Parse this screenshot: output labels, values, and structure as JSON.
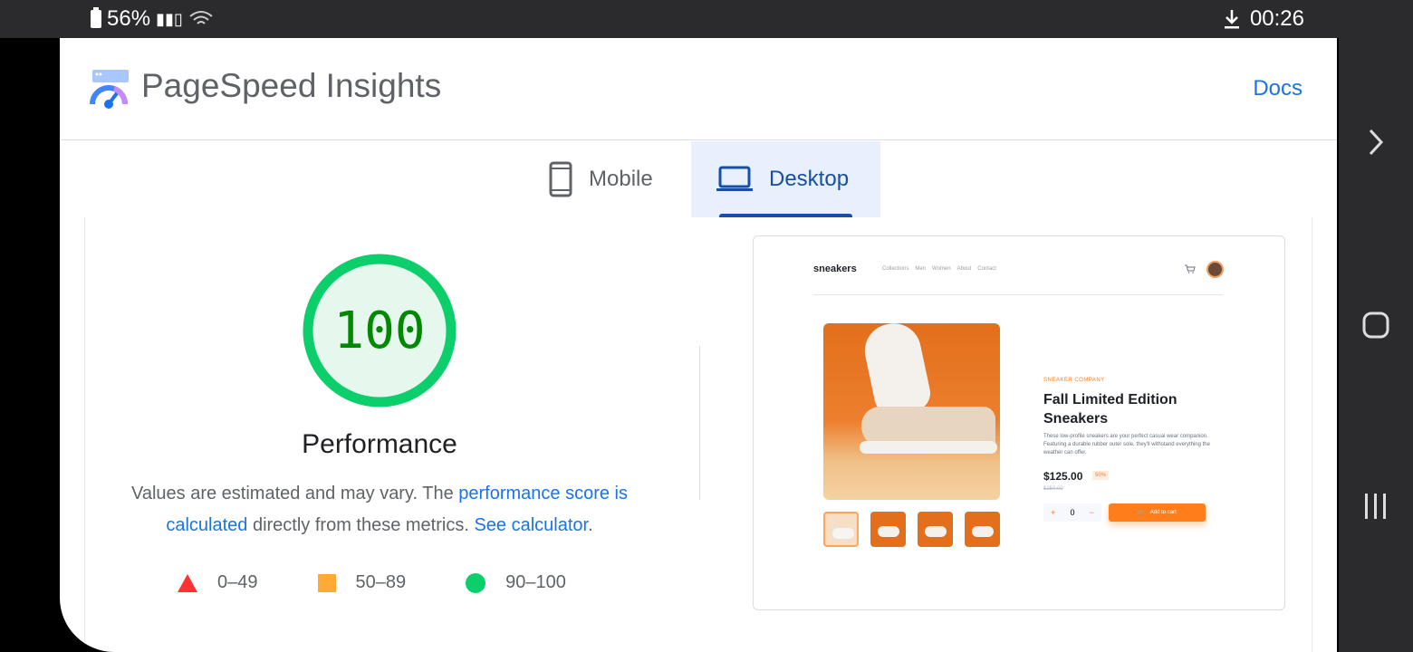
{
  "status_bar": {
    "battery": "56%",
    "time": "00:26"
  },
  "header": {
    "title": "PageSpeed Insights",
    "docs_label": "Docs"
  },
  "tabs": [
    {
      "label": "Mobile",
      "selected": false
    },
    {
      "label": "Desktop",
      "selected": true
    }
  ],
  "performance": {
    "score": "100",
    "score_value": 100,
    "score_color": "#0cce6b",
    "title": "Performance",
    "desc_part1": "Values are estimated and may vary. The ",
    "desc_link1": "performance score is calculated",
    "desc_part2": " directly from these metrics. ",
    "desc_link2": "See calculator",
    "desc_part3": "."
  },
  "legend": [
    {
      "range": "0–49",
      "shape": "triangle",
      "color": "#ff3333"
    },
    {
      "range": "50–89",
      "shape": "square",
      "color": "#ffaa33"
    },
    {
      "range": "90–100",
      "shape": "circle",
      "color": "#0cce6b"
    }
  ],
  "screenshot": {
    "brand": "sneakers",
    "nav": [
      "Collections",
      "Men",
      "Women",
      "About",
      "Contact"
    ],
    "company": "SNEAKER COMPANY",
    "product_title": "Fall Limited Edition Sneakers",
    "description": "These low-profile sneakers are your perfect casual wear companion. Featuring a durable rubber outer sole, they'll withstand everything the weather can offer.",
    "price": "$125.00",
    "discount": "50%",
    "old_price": "$250.00",
    "qty_minus": "+",
    "quantity": "0",
    "qty_plus": "−",
    "add_to_cart": "Add to cart"
  }
}
